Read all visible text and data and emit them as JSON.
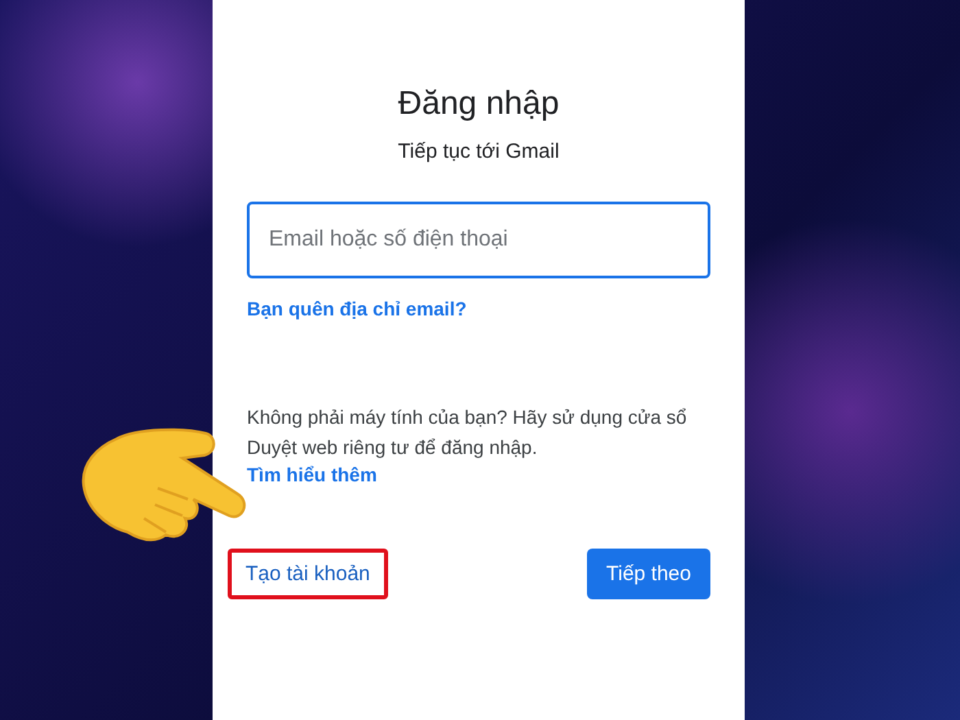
{
  "title": "Đăng nhập",
  "subtitle": "Tiếp tục tới Gmail",
  "email_field": {
    "placeholder": "Email hoặc số điện thoại"
  },
  "forgot_link": "Bạn quên địa chỉ email?",
  "notice": "Không phải máy tính của bạn? Hãy sử dụng cửa sổ Duyệt web riêng tư để đăng nhập.",
  "learn_more_link": "Tìm hiểu thêm",
  "buttons": [
    {
      "kind": "text",
      "label": "Tạo tài khoản",
      "highlighted": true
    },
    {
      "kind": "filled",
      "label": "Tiếp theo",
      "highlighted": false
    }
  ],
  "pointer_hand": true
}
